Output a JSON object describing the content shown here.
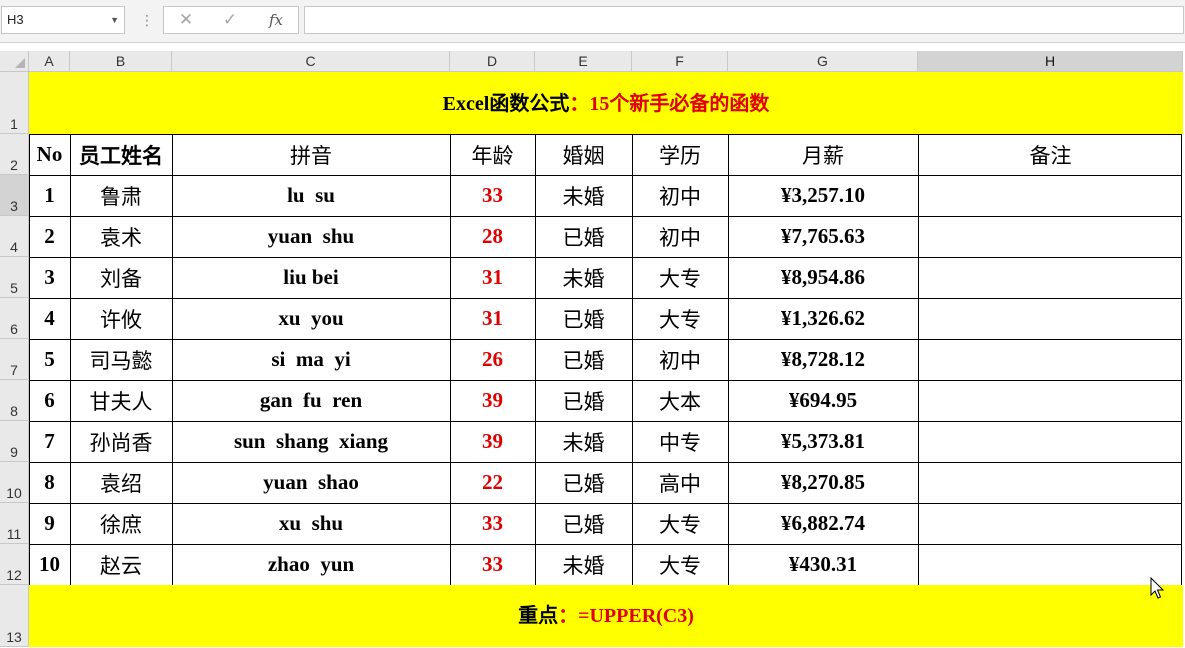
{
  "formula_bar": {
    "name_box": "H3",
    "cancel_icon": "✕",
    "enter_icon": "✓",
    "fx_label": "fx",
    "formula": ""
  },
  "columns": [
    "A",
    "B",
    "C",
    "D",
    "E",
    "F",
    "G",
    "H"
  ],
  "selected_column": "H",
  "rows": [
    "1",
    "2",
    "3",
    "4",
    "5",
    "6",
    "7",
    "8",
    "9",
    "10",
    "11",
    "12",
    "13"
  ],
  "selected_row": "3",
  "title": {
    "prefix": "Excel函数公式",
    "suffix": "：15个新手必备的函数"
  },
  "table": {
    "headers": [
      "No",
      "员工姓名",
      "拼音",
      "年龄",
      "婚姻",
      "学历",
      "月薪",
      "备注"
    ],
    "records": [
      {
        "no": "1",
        "name": "鲁肃",
        "pinyin": "lu  su",
        "age": "33",
        "marriage": "未婚",
        "edu": "初中",
        "salary": "¥3,257.10",
        "note": ""
      },
      {
        "no": "2",
        "name": "袁术",
        "pinyin": "yuan  shu",
        "age": "28",
        "marriage": "已婚",
        "edu": "初中",
        "salary": "¥7,765.63",
        "note": ""
      },
      {
        "no": "3",
        "name": "刘备",
        "pinyin": "liu bei",
        "age": "31",
        "marriage": "未婚",
        "edu": "大专",
        "salary": "¥8,954.86",
        "note": ""
      },
      {
        "no": "4",
        "name": "许攸",
        "pinyin": "xu  you",
        "age": "31",
        "marriage": "已婚",
        "edu": "大专",
        "salary": "¥1,326.62",
        "note": ""
      },
      {
        "no": "5",
        "name": "司马懿",
        "pinyin": "si  ma  yi",
        "age": "26",
        "marriage": "已婚",
        "edu": "初中",
        "salary": "¥8,728.12",
        "note": ""
      },
      {
        "no": "6",
        "name": "甘夫人",
        "pinyin": "gan  fu  ren",
        "age": "39",
        "marriage": "已婚",
        "edu": "大本",
        "salary": "¥694.95",
        "note": ""
      },
      {
        "no": "7",
        "name": "孙尚香",
        "pinyin": "sun  shang  xiang",
        "age": "39",
        "marriage": "未婚",
        "edu": "中专",
        "salary": "¥5,373.81",
        "note": ""
      },
      {
        "no": "8",
        "name": "袁绍",
        "pinyin": "yuan  shao",
        "age": "22",
        "marriage": "已婚",
        "edu": "高中",
        "salary": "¥8,270.85",
        "note": ""
      },
      {
        "no": "9",
        "name": "徐庶",
        "pinyin": "xu  shu",
        "age": "33",
        "marriage": "已婚",
        "edu": "大专",
        "salary": "¥6,882.74",
        "note": ""
      },
      {
        "no": "10",
        "name": "赵云",
        "pinyin": "zhao  yun",
        "age": "33",
        "marriage": "未婚",
        "edu": "大专",
        "salary": "¥430.31",
        "note": ""
      }
    ]
  },
  "footer": {
    "prefix": "重点",
    "suffix": "：=UPPER(C3)"
  },
  "colors": {
    "band": "#ffff00",
    "accent_red": "#e00000",
    "selection": "#217346"
  }
}
